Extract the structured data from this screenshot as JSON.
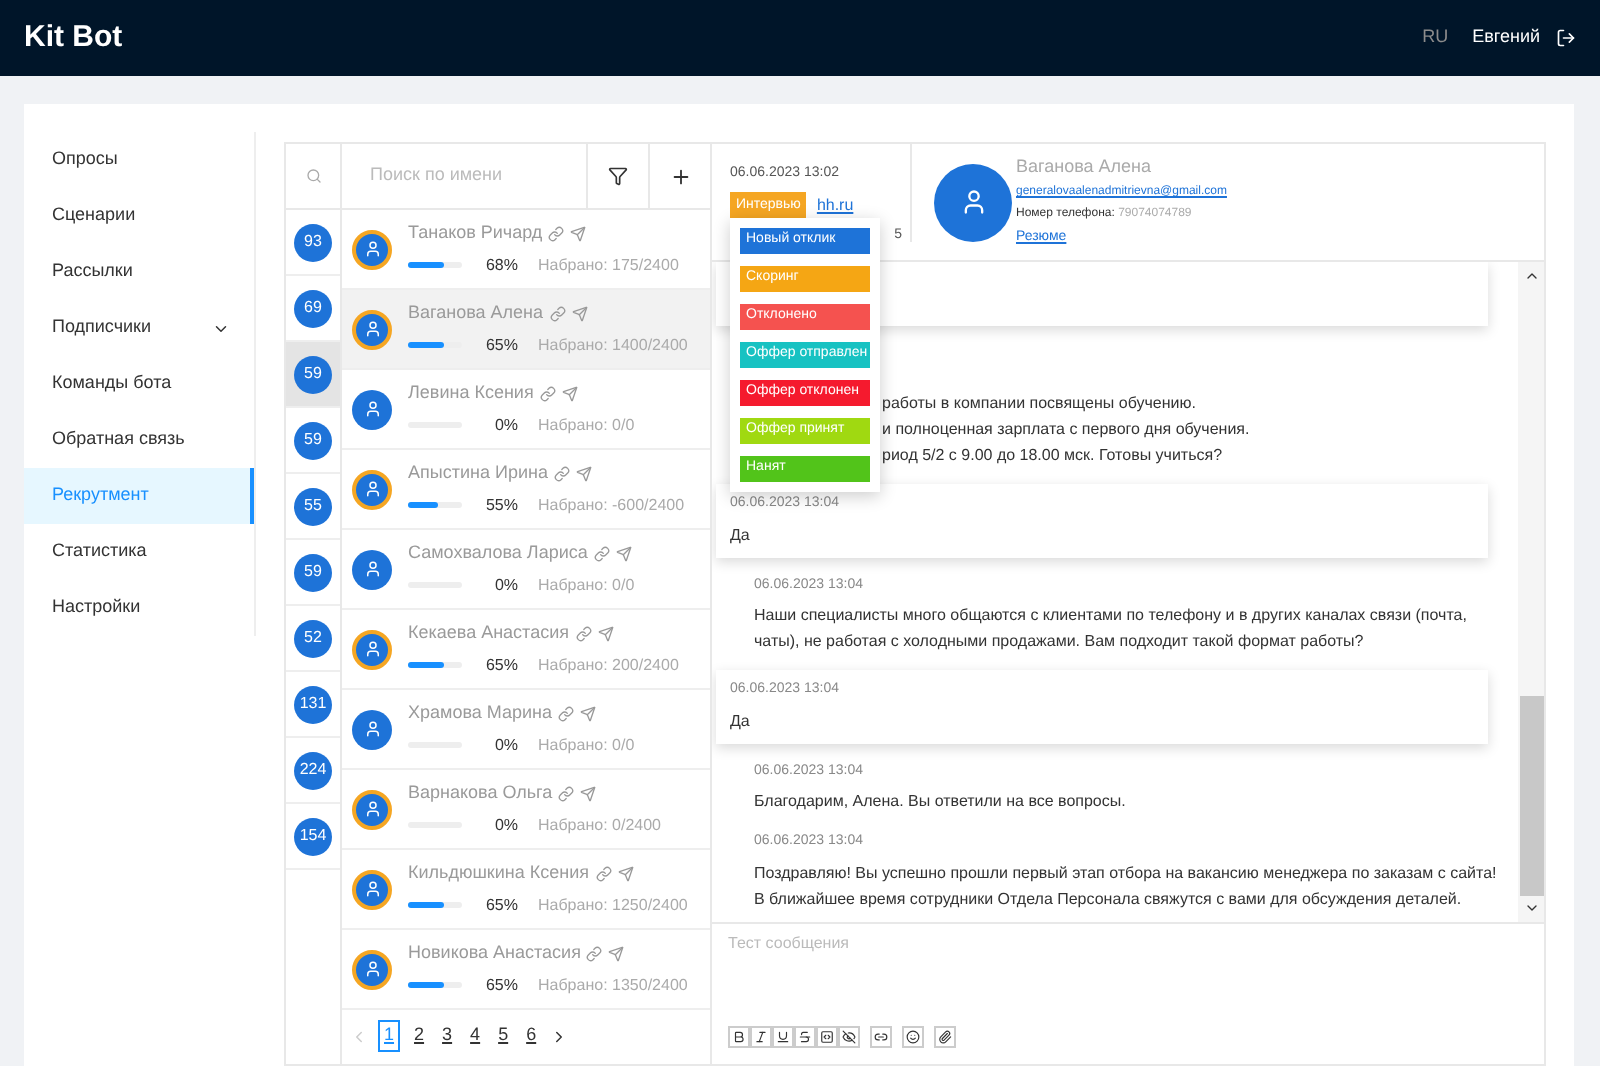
{
  "header": {
    "logo": "Kit Bot",
    "language": {
      "label": "RU",
      "selected": false
    },
    "user": "Евгений"
  },
  "sidebar": {
    "items": [
      {
        "label": "Опросы",
        "selected": false
      },
      {
        "label": "Сценарии",
        "selected": false
      },
      {
        "label": "Рассылки",
        "selected": false
      },
      {
        "label": "Подписчики",
        "selected": false,
        "expandable": true
      },
      {
        "label": "Команды бота",
        "selected": false
      },
      {
        "label": "Обратная связь",
        "selected": false
      },
      {
        "label": "Рекрутмент",
        "selected": true
      },
      {
        "label": "Статистика",
        "selected": false
      },
      {
        "label": "Настройки",
        "selected": false
      }
    ]
  },
  "search": {
    "placeholder": "Поиск по имени"
  },
  "counts": [
    {
      "value": "93",
      "selected": false
    },
    {
      "value": "69",
      "selected": false
    },
    {
      "value": "59",
      "selected": true
    },
    {
      "value": "59",
      "selected": false
    },
    {
      "value": "55",
      "selected": false
    },
    {
      "value": "59",
      "selected": false
    },
    {
      "value": "52",
      "selected": false
    },
    {
      "value": "131",
      "selected": false
    },
    {
      "value": "224",
      "selected": false
    },
    {
      "value": "154",
      "selected": false
    }
  ],
  "candidates": [
    {
      "name": "Танаков Ричард",
      "percent": "68%",
      "level": 0.68,
      "score": "Набрано: 175/2400",
      "ring": true,
      "selected": false
    },
    {
      "name": "Ваганова Алена",
      "percent": "65%",
      "level": 0.65,
      "score": "Набрано: 1400/2400",
      "ring": true,
      "selected": true
    },
    {
      "name": "Левина Ксения",
      "percent": "0%",
      "level": 0,
      "score": "Набрано: 0/0",
      "ring": false,
      "selected": false
    },
    {
      "name": "Апыстина Ирина",
      "percent": "55%",
      "level": 0.55,
      "score": "Набрано: -600/2400",
      "ring": true,
      "selected": false
    },
    {
      "name": "Самохвалова Лариса",
      "percent": "0%",
      "level": 0,
      "score": "Набрано: 0/0",
      "ring": false,
      "selected": false
    },
    {
      "name": "Кекаева Анастасия",
      "percent": "65%",
      "level": 0.65,
      "score": "Набрано: 200/2400",
      "ring": true,
      "selected": false
    },
    {
      "name": "Храмова Марина",
      "percent": "0%",
      "level": 0,
      "score": "Набрано: 0/0",
      "ring": false,
      "selected": false
    },
    {
      "name": "Варнакова Ольга",
      "percent": "0%",
      "level": 0,
      "score": "Набрано: 0/2400",
      "ring": true,
      "selected": false
    },
    {
      "name": "Кильдюшкина Ксения",
      "percent": "65%",
      "level": 0.65,
      "score": "Набрано: 1250/2400",
      "ring": true,
      "selected": false
    },
    {
      "name": "Новикова Анастасия",
      "percent": "65%",
      "level": 0.65,
      "score": "Набрано: 1350/2400",
      "ring": true,
      "selected": false
    }
  ],
  "pagination": [
    {
      "label": "1",
      "selected": true
    },
    {
      "label": "2",
      "selected": false
    },
    {
      "label": "3",
      "selected": false
    },
    {
      "label": "4",
      "selected": false
    },
    {
      "label": "5",
      "selected": false
    },
    {
      "label": "6",
      "selected": false
    }
  ],
  "chat_header": {
    "date": "06.06.2023 13:02",
    "status": "Интервью",
    "source": "hh.ru",
    "fragment": "5",
    "name": "Ваганова Алена",
    "email": "generalovaalenadmitrievna@gmail.com",
    "phone_label": "Номер телефона:",
    "phone": "79074074789",
    "resume": "Резюме"
  },
  "status_menu": [
    {
      "label": "Новый отклик",
      "color": "#1e73d8"
    },
    {
      "label": "Скоринг",
      "color": "#f5a614"
    },
    {
      "label": "Отклонено",
      "color": "#f5524f"
    },
    {
      "label": "Оффер отправлен",
      "color": "#17c2c2"
    },
    {
      "label": "Оффер отклонен",
      "color": "#f51a2e"
    },
    {
      "label": "Оффер принят",
      "color": "#a0d911"
    },
    {
      "label": "Нанят",
      "color": "#52c41a"
    }
  ],
  "messages": [
    {
      "kind": "incoming"
    },
    {
      "kind": "partial",
      "lines": [
        "работы в компании посвящены обучению.",
        "и полноценная зарплата с первого дня обучения.",
        "риод 5/2 с 9.00 до 18.00 мск. Готовы учиться?"
      ]
    },
    {
      "kind": "incoming",
      "time": "06.06.2023 13:04",
      "text": "Да"
    },
    {
      "kind": "outgoing",
      "time": "06.06.2023 13:04",
      "text": "Наши специалисты много общаются с клиентами по телефону и в других каналах связи (почта, чаты), не работая с холодными продажами. Вам подходит такой формат работы?"
    },
    {
      "kind": "incoming",
      "time": "06.06.2023 13:04",
      "text": "Да"
    },
    {
      "kind": "outgoing",
      "time": "06.06.2023 13:04",
      "text": "Благодарим, Алена. Вы ответили на все вопросы."
    },
    {
      "kind": "outgoing",
      "time": "06.06.2023 13:04",
      "text": "Поздравляю! Вы успешно прошли первый этап отбора на вакансию менеджера по заказам с сайта! В ближайшее время сотрудники Отдела Персонала свяжутся с вами для обсуждения деталей."
    }
  ],
  "composer": {
    "placeholder": "Тест сообщения"
  }
}
